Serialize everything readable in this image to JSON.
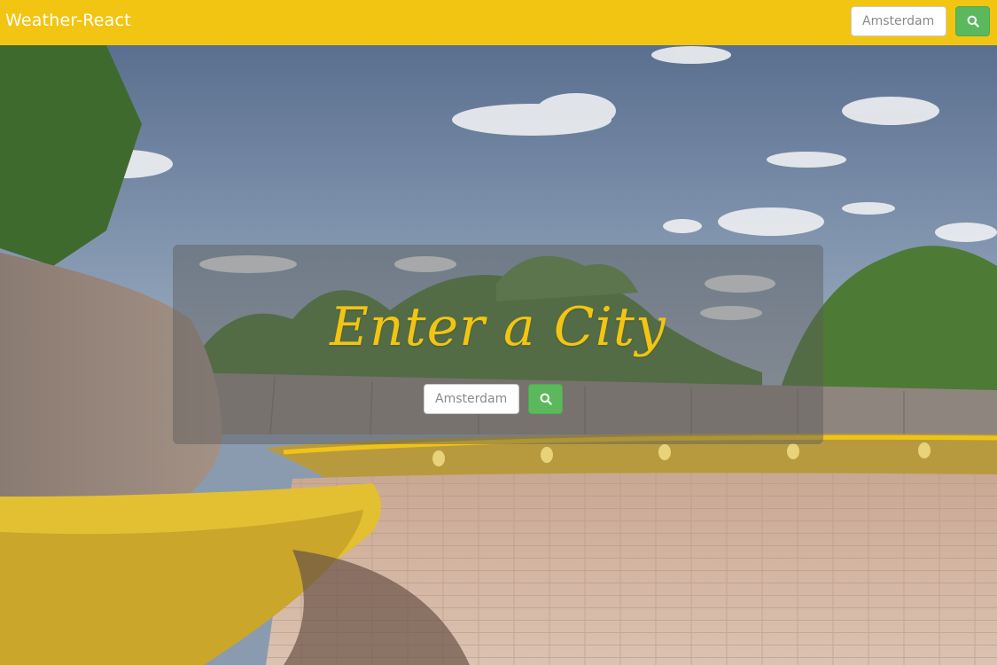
{
  "navbar": {
    "brand": "Weather-React",
    "search": {
      "placeholder": "Amsterdam",
      "value": ""
    },
    "search_button_icon": "search-icon"
  },
  "main": {
    "title": "Enter a City",
    "search": {
      "placeholder": "Amsterdam",
      "value": ""
    },
    "search_button_icon": "search-icon"
  },
  "colors": {
    "navbar_bg": "#f2c512",
    "title": "#f2c512",
    "button_bg": "#5cb85c",
    "panel_overlay": "rgba(90,90,90,0.45)"
  }
}
